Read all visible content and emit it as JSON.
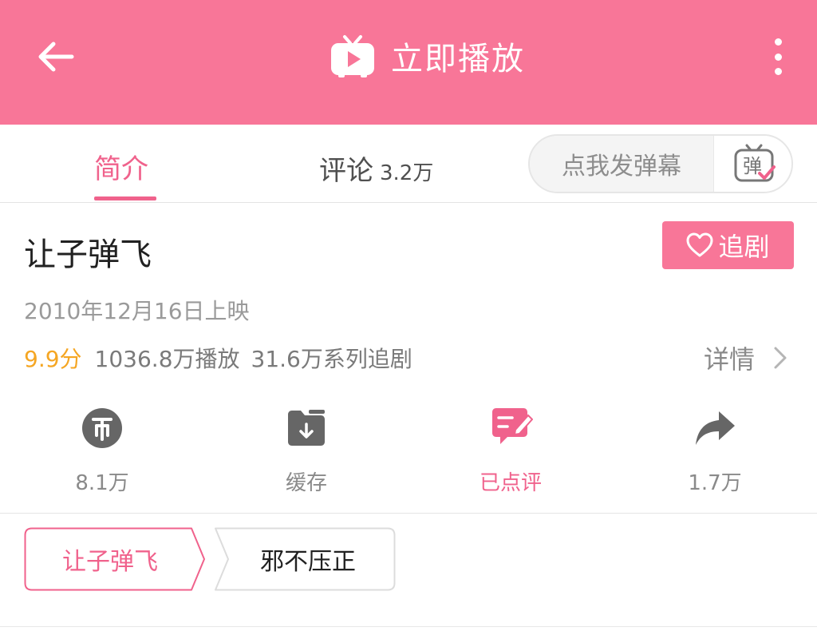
{
  "header": {
    "title": "立即播放",
    "back_icon": "arrow-left-icon",
    "tv_icon": "tv-play-icon",
    "more_icon": "more-vertical-icon",
    "background_color": "#f87698"
  },
  "tabs": {
    "intro_label": "简介",
    "comments_label": "评论",
    "comments_count": "3.2万",
    "danmaku_placeholder": "点我发弹幕",
    "danmaku_icon": "danmaku-tv-icon",
    "danmaku_icon_text": "弹"
  },
  "show": {
    "title": "让子弹飞",
    "follow_label": "追剧",
    "follow_icon": "heart-outline-icon",
    "release": "2010年12月16日上映",
    "score": "9.9分",
    "plays": "1036.8万播放",
    "follows": "31.6万系列追剧",
    "details_label": "详情",
    "details_icon": "chevron-right-icon"
  },
  "actions": [
    {
      "icon": "coin-icon",
      "label": "8.1万",
      "active": false
    },
    {
      "icon": "download-folder-icon",
      "label": "缓存",
      "active": false
    },
    {
      "icon": "review-edit-icon",
      "label": "已点评",
      "active": true
    },
    {
      "icon": "share-arrow-icon",
      "label": "1.7万",
      "active": false
    }
  ],
  "series": [
    {
      "label": "让子弹飞",
      "selected": true
    },
    {
      "label": "邪不压正",
      "selected": false
    }
  ],
  "colors": {
    "accent": "#f0628c",
    "score": "#f5a623",
    "muted": "#8a8a8a"
  }
}
